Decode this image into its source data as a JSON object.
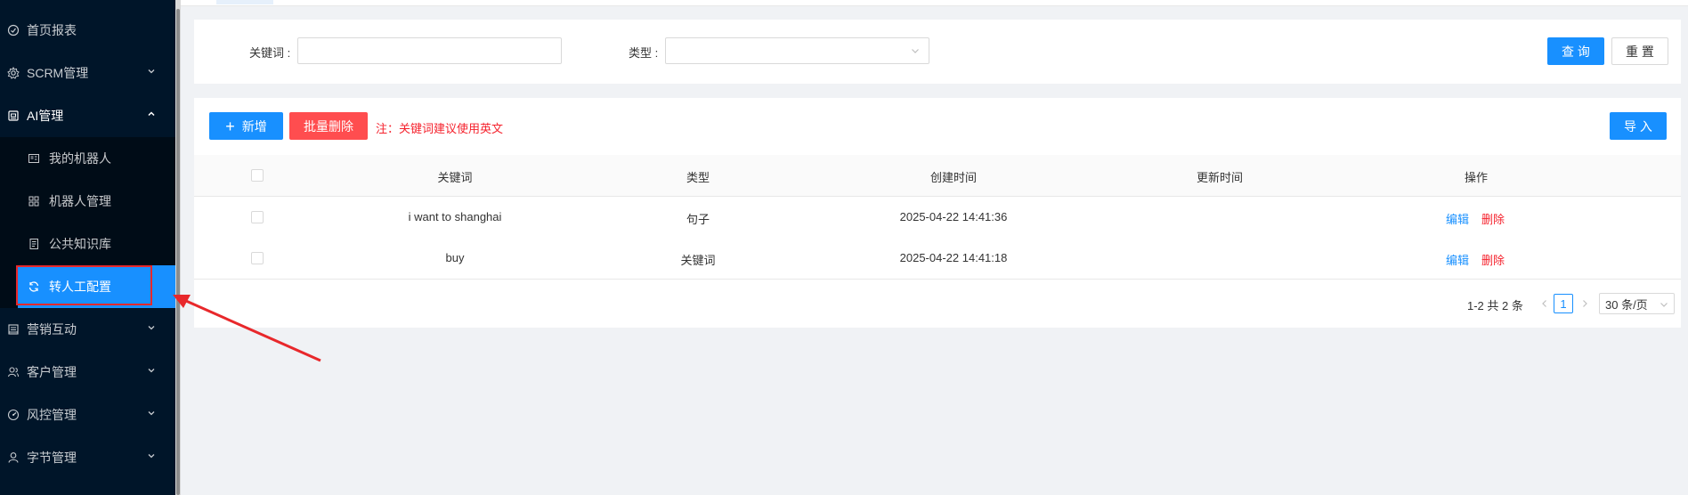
{
  "sidebar": {
    "items": [
      {
        "label": "首页报表",
        "icon": "dashboard-icon"
      },
      {
        "label": "SCRM管理",
        "icon": "gear-icon"
      },
      {
        "label": "AI管理",
        "icon": "robot-icon"
      },
      {
        "label": "营销互动",
        "icon": "marketing-icon"
      },
      {
        "label": "客户管理",
        "icon": "users-icon"
      },
      {
        "label": "风控管理",
        "icon": "gauge-icon"
      },
      {
        "label": "字节管理",
        "icon": "user-icon"
      }
    ],
    "ai_submenu": [
      {
        "label": "我的机器人",
        "icon": "id-card-icon"
      },
      {
        "label": "机器人管理",
        "icon": "grid-icon"
      },
      {
        "label": "公共知识库",
        "icon": "book-icon"
      },
      {
        "label": "转人工配置",
        "icon": "refresh-icon"
      }
    ],
    "active_item": "转人工配置"
  },
  "search": {
    "keyword_label": "关键词 :",
    "keyword_value": "",
    "type_label": "类型 :",
    "type_value": "",
    "query_button": "查 询",
    "reset_button": "重 置"
  },
  "toolbar": {
    "add_button": "新增",
    "batch_delete_button": "批量删除",
    "note": "注：关键词建议使用英文",
    "import_button": "导 入"
  },
  "table": {
    "columns": [
      "关键词",
      "类型",
      "创建时间",
      "更新时间",
      "操作"
    ],
    "rows": [
      {
        "keyword": "i want to shanghai",
        "type": "句子",
        "created": "2025-04-22 14:41:36",
        "updated": "",
        "edit": "编辑",
        "delete": "删除"
      },
      {
        "keyword": "buy",
        "type": "关键词",
        "created": "2025-04-22 14:41:18",
        "updated": "",
        "edit": "编辑",
        "delete": "删除"
      }
    ]
  },
  "pagination": {
    "total": "1-2 共 2 条",
    "current_page": "1",
    "page_size": "30 条/页"
  },
  "colors": {
    "sidebar_bg": "#001529",
    "primary": "#1890ff",
    "danger": "#ff4d4f",
    "annotation_red": "#e8282b"
  }
}
